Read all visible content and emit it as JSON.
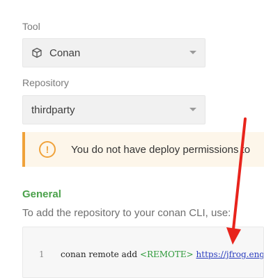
{
  "form": {
    "tool_label": "Tool",
    "tool_value": "Conan",
    "repository_label": "Repository",
    "repository_value": "thirdparty"
  },
  "alert": {
    "text": "You do not have deploy permissions to",
    "icon": "warning-circle-icon"
  },
  "general": {
    "title": "General",
    "description": "To add the repository to your conan CLI, use:"
  },
  "code": {
    "line_number": "1",
    "command": "conan remote add ",
    "placeholder": "<REMOTE>",
    "url": "https://jfrog.eng.s"
  },
  "colors": {
    "accent_green": "#4aa14a",
    "warning": "#f0a23a",
    "annotation_arrow": "#e8241c"
  }
}
